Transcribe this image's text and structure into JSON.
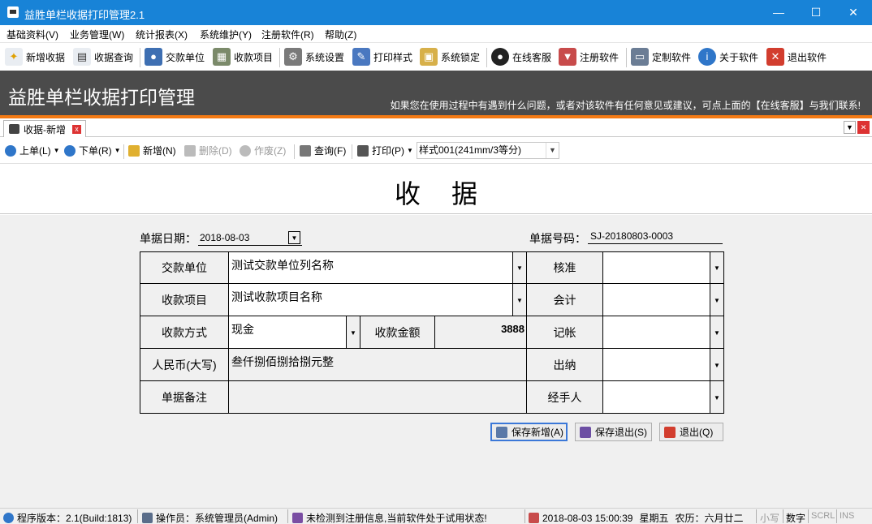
{
  "window": {
    "title": "益胜单栏收据打印管理2.1",
    "controls": {
      "minimize": "—",
      "maximize": "☐",
      "close": "✕"
    }
  },
  "menu": [
    "基础资料(V)",
    "业务管理(W)",
    "统计报表(X)",
    "系统维护(Y)",
    "注册软件(R)",
    "帮助(Z)"
  ],
  "toolbar": [
    "新增收据",
    "收据查询",
    "交款单位",
    "收款项目",
    "系统设置",
    "打印样式",
    "系统锁定",
    "在线客服",
    "注册软件",
    "定制软件",
    "关于软件",
    "退出软件"
  ],
  "banner": {
    "title": "益胜单栏收据打印管理",
    "message": "如果您在使用过程中有遇到什么问题，或者对该软件有任何意见或建议，可点上面的【在线客服】与我们联系!"
  },
  "tab": {
    "label": "收据-新增",
    "close": "x"
  },
  "subtoolbar": {
    "prev": "上单(L)",
    "next": "下单(R)",
    "new": "新增(N)",
    "delete": "删除(D)",
    "void": "作废(Z)",
    "query": "查询(F)",
    "print": "打印(P)",
    "style_value": "样式001(241mm/3等分)"
  },
  "receipt": {
    "heading": "收据",
    "date_label": "单据日期：",
    "date_value": "2018-08-03",
    "no_label": "单据号码：",
    "no_value": "SJ-20180803-0003",
    "payer_label": "交款单位",
    "payer_value": "测试交款单位列名称",
    "item_label": "收款项目",
    "item_value": "测试收款项目名称",
    "method_label": "收款方式",
    "method_value": "现金",
    "amount_label": "收款金额",
    "amount_value": "3888",
    "rmb_label": "人民币(大写)",
    "rmb_value": "叁仟捌佰捌拾捌元整",
    "remark_label": "单据备注",
    "remark_value": "",
    "approve_label": "核准",
    "accountant_label": "会计",
    "bookkeep_label": "记帐",
    "cashier_label": "出纳",
    "handler_label": "经手人"
  },
  "buttons": {
    "save_new": "保存新增(A)",
    "save_exit": "保存退出(S)",
    "exit": "退出(Q)"
  },
  "status": {
    "version": "程序版本：2.1(Build:1813)",
    "operator": "操作员：系统管理员(Admin)",
    "register": "未检测到注册信息,当前软件处于试用状态!",
    "datetime": "2018-08-03 15:00:39",
    "weekday": "星期五",
    "lunar": "农历：六月廿二",
    "caps": "小写",
    "num": "数字",
    "scrl": "SCRL",
    "ins": "INS"
  }
}
